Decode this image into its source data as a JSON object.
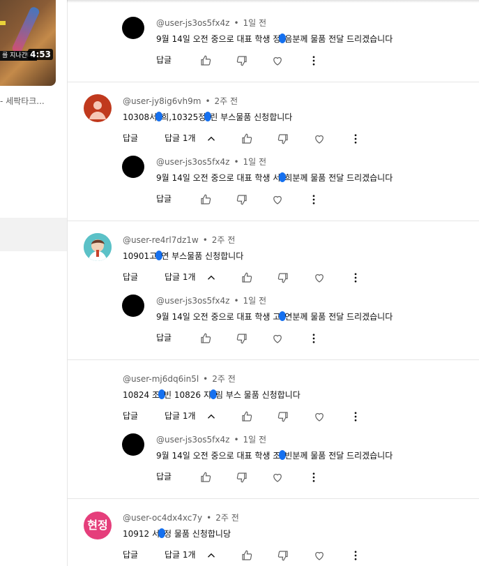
{
  "sidebar": {
    "video_caption": "를 지나간다.",
    "video_duration": "4:53",
    "video_title": "- 세팍타크..."
  },
  "actions": {
    "reply_label": "답글",
    "replies_label": "답글 1개"
  },
  "colors": {
    "redaction": "#1570ef",
    "meta_text": "#606060"
  },
  "comments": [
    {
      "author": "@user-js3os5fx4z",
      "time": "1일 전",
      "text_a": "9월 14일 오전 중으로 대표 학생 정",
      "text_b": "음분께 물품 전달 드리겠습니다"
    },
    {
      "author": "@user-jy8ig6vh9m",
      "time": "2주 전",
      "text_a": "10308서",
      "text_b": "희,10325정",
      "text_c": "린 부스물품 신청합니다",
      "avatar_icon": "person-icon"
    },
    {
      "author": "@user-js3os5fx4z",
      "time": "1일 전",
      "text_a": "9월 14일 오전 중으로 대표 학생 서",
      "text_b": "희분께 물품 전달 드리겠습니다"
    },
    {
      "author": "@user-re4rl7dz1w",
      "time": "2주 전",
      "text_a": "10901고",
      "text_b": "연 부스물품 신청합니다",
      "avatar_icon": "cartoon-avatar-icon"
    },
    {
      "author": "@user-js3os5fx4z",
      "time": "1일 전",
      "text_a": "9월 14일 오전 중으로 대표 학생 고",
      "text_b": "연분께 물품 전달 드리겠습니다"
    },
    {
      "author": "@user-mj6dq6in5l",
      "time": "2주 전",
      "text_a": "10824 조",
      "text_b": "빈 10826 지",
      "text_c": "림 부스 물품 신청합니다"
    },
    {
      "author": "@user-js3os5fx4z",
      "time": "1일 전",
      "text_a": "9월 14일 오전 중으로 대표 학생 조",
      "text_b": "빈분께 물품 전달 드리겠습니다"
    },
    {
      "author": "@user-oc4dx4xc7y",
      "time": "2주 전",
      "text_a": "10912 서",
      "text_b": "정 물품 신청합니당",
      "avatar_text": "현정"
    }
  ]
}
